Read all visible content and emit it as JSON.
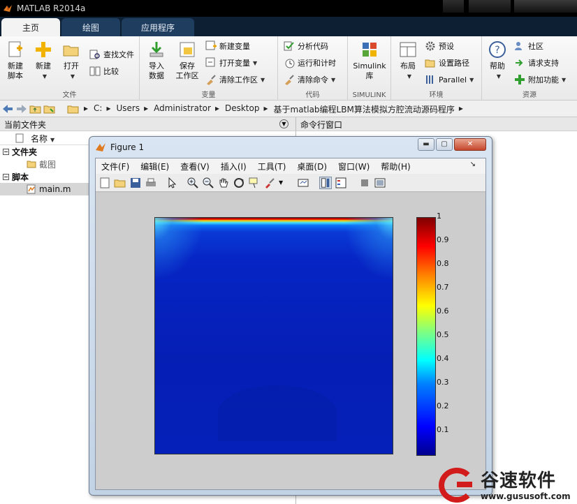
{
  "window": {
    "title": "MATLAB R2014a"
  },
  "tabs": [
    {
      "label": "主页"
    },
    {
      "label": "绘图"
    },
    {
      "label": "应用程序"
    }
  ],
  "ribbon": {
    "file": {
      "group_label": "文件",
      "new_script_line1": "新建",
      "new_script_line2": "脚本",
      "new": "新建",
      "open": "打开",
      "find_files": "查找文件",
      "compare": "比较"
    },
    "variable": {
      "group_label": "变量",
      "import_line1": "导入",
      "import_line2": "数据",
      "save_line1": "保存",
      "save_line2": "工作区",
      "new_variable": "新建变量",
      "open_variable": "打开变量",
      "clear_workspace": "清除工作区"
    },
    "code": {
      "group_label": "代码",
      "analyze": "分析代码",
      "run_time": "运行和计时",
      "clear_commands": "清除命令"
    },
    "simulink": {
      "group_label": "SIMULINK",
      "lib_line1": "Simulink",
      "lib_line2": "库"
    },
    "environment": {
      "group_label": "环境",
      "layout": "布局",
      "preferences": "预设",
      "set_path": "设置路径",
      "parallel": "Parallel"
    },
    "resources": {
      "group_label": "资源",
      "help": "帮助",
      "community": "社区",
      "request_support": "请求支持",
      "addons": "附加功能"
    }
  },
  "address": {
    "crumbs": [
      "C:",
      "Users",
      "Administrator",
      "Desktop",
      "基于matlab编程LBM算法模拟方腔流动源码程序"
    ]
  },
  "current_folder": {
    "title": "当前文件夹",
    "column_name": "名称",
    "folders_header": "文件夹",
    "folder_item": "截图",
    "scripts_header": "脚本",
    "script_item": "main.m"
  },
  "command_window": {
    "title": "命令行窗口"
  },
  "figure": {
    "title": "Figure 1",
    "menu": [
      "文件(F)",
      "编辑(E)",
      "查看(V)",
      "插入(I)",
      "工具(T)",
      "桌面(D)",
      "窗口(W)",
      "帮助(H)"
    ]
  },
  "colorbar": {
    "ticks": [
      "1",
      "0.9",
      "0.8",
      "0.7",
      "0.6",
      "0.5",
      "0.4",
      "0.3",
      "0.2",
      "0.1"
    ]
  },
  "watermark": {
    "name": "谷速软件",
    "url": "www.gususoft.com"
  }
}
